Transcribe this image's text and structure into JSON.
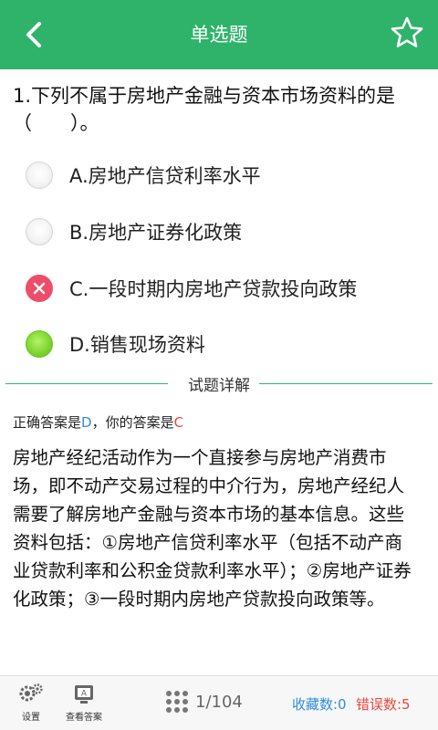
{
  "header": {
    "title": "单选题"
  },
  "question": {
    "text": "1.下列不属于房地产金融与资本市场资料的是（　　）。"
  },
  "options": [
    {
      "label": "A.房地产信贷利率水平",
      "state": "empty"
    },
    {
      "label": "B.房地产证券化政策",
      "state": "empty"
    },
    {
      "label": "C.一段时期内房地产贷款投向政策",
      "state": "wrong"
    },
    {
      "label": "D.销售现场资料",
      "state": "correct"
    }
  ],
  "details": {
    "title": "试题详解",
    "correct_prefix": "正确答案是",
    "correct_value": "D",
    "your_prefix": "，你的答案是",
    "your_value": "C",
    "explanation": "房地产经纪活动作为一个直接参与房地产消费市场，即不动产交易过程的中介行为，房地产经纪人需要了解房地产金融与资本市场的基本信息。这些资料包括：①房地产信贷利率水平（包括不动产商业贷款利率和公积金贷款利率水平）；②房地产证券化政策；③一段时期内房地产贷款投向政策等。"
  },
  "footer": {
    "settings_label": "设置",
    "view_answer_label": "查看答案",
    "page": "1/104",
    "favorites": "收藏数:0",
    "errors": "错误数:5"
  },
  "colors": {
    "header_bg": "#2fb36a",
    "correct_answer": "#2b8de0",
    "user_answer": "#e8483f",
    "wrong_option": "#ee4d6a",
    "correct_option": "#7fd72f"
  },
  "icons": {
    "back": "chevron-left-icon",
    "favorite": "star-icon",
    "settings": "gear-icon",
    "view_answer": "answer-card-icon",
    "page_grid": "grid-icon"
  }
}
